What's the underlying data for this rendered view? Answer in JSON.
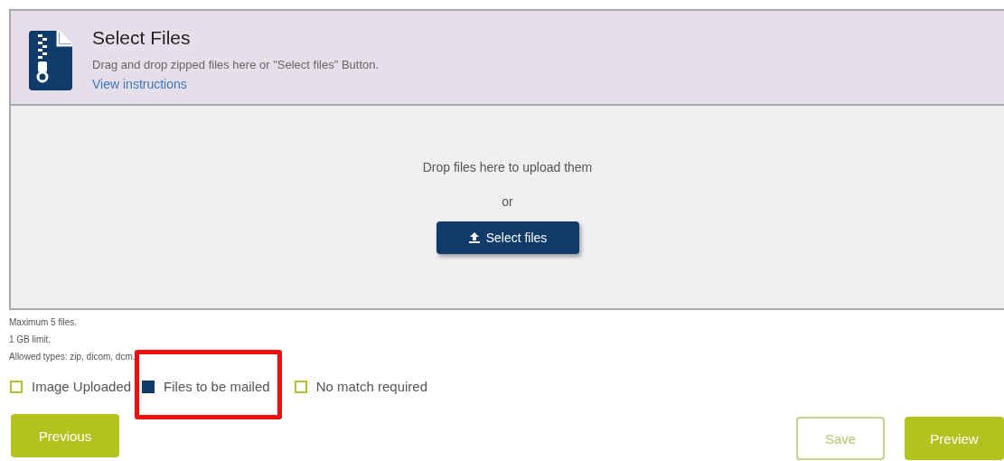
{
  "upload_panel": {
    "title": "Select Files",
    "description": "Drag and drop zipped files here or \"Select files\" Button.",
    "link": "View instructions",
    "drop_hint": "Drop files here to upload them",
    "separator": "or",
    "button": "Select files"
  },
  "notes": [
    "Maximum 5 files.",
    "1 GB limit.",
    "Allowed types: zip, dicom, dcm."
  ],
  "checkboxes": [
    {
      "label": "Image Uploaded",
      "checked": false,
      "highlighted": false
    },
    {
      "label": "Files to be mailed",
      "checked": true,
      "highlighted": true
    },
    {
      "label": "No match required",
      "checked": false,
      "highlighted": false
    }
  ],
  "buttons": [
    {
      "label": "Previous",
      "kind": "filled"
    },
    {
      "label": "Save",
      "kind": "outline"
    },
    {
      "label": "Preview",
      "kind": "filled"
    }
  ]
}
